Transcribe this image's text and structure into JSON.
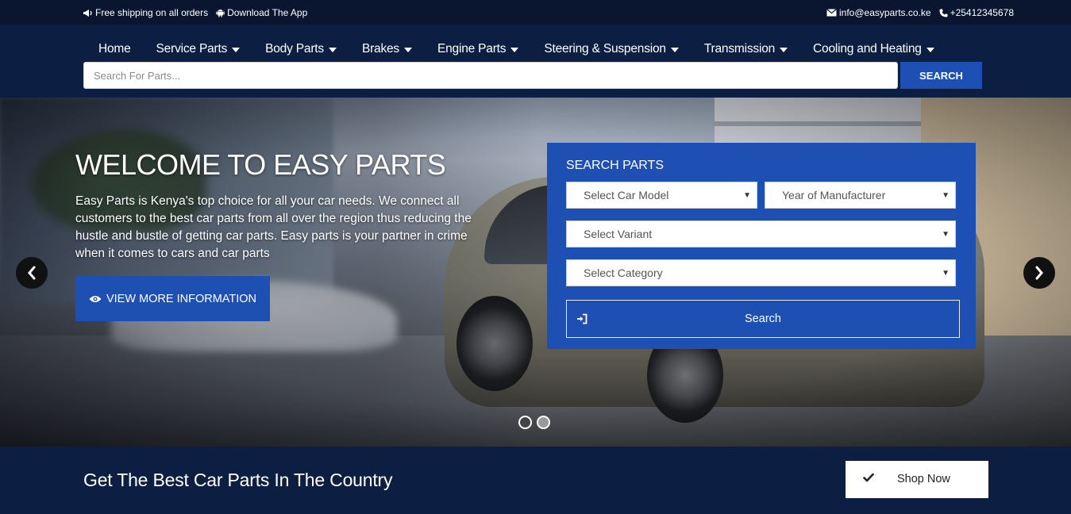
{
  "topbar": {
    "shipping_text": "Free shipping on all orders",
    "shipping_icon": "megaphone-icon",
    "app_text": "Download The App",
    "app_icon": "android-icon",
    "email": "info@easyparts.co.ke",
    "email_icon": "envelope-icon",
    "phone": "+25412345678",
    "phone_icon": "phone-icon"
  },
  "nav": {
    "items": [
      {
        "label": "Home",
        "has_dropdown": false
      },
      {
        "label": "Service Parts",
        "has_dropdown": true
      },
      {
        "label": "Body Parts",
        "has_dropdown": true
      },
      {
        "label": "Brakes",
        "has_dropdown": true
      },
      {
        "label": "Engine Parts",
        "has_dropdown": true
      },
      {
        "label": "Steering & Suspension",
        "has_dropdown": true
      },
      {
        "label": "Transmission",
        "has_dropdown": true
      },
      {
        "label": "Cooling and Heating",
        "has_dropdown": true
      }
    ]
  },
  "search": {
    "placeholder": "Search For Parts...",
    "button_label": "SEARCH"
  },
  "hero": {
    "title": "WELCOME TO EASY PARTS",
    "description": "Easy Parts is Kenya's top choice for all your car needs. We connect all customers to the best car parts from all over the region thus reducing the hustle and bustle of getting car parts. Easy parts is your partner in crime when it comes to cars and car parts",
    "more_button_label": "VIEW MORE INFORMATION",
    "more_button_icon": "eye-icon",
    "prev_icon": "chevron-left-icon",
    "next_icon": "chevron-right-icon",
    "slide_count": 2,
    "active_slide": 2
  },
  "search_panel": {
    "title": "SEARCH PARTS",
    "car_model": "Select Car Model",
    "year": "Year of Manufacturer",
    "variant": "Select Variant",
    "category": "Select Category",
    "search_label": "Search",
    "search_icon": "sign-in-icon"
  },
  "cta": {
    "title": "Get The Best Car Parts In The Country",
    "button_label": "Shop Now",
    "button_icon": "check-icon"
  },
  "colors": {
    "topbar_bg": "#0a1630",
    "nav_bg": "#0c1f42",
    "accent_blue": "#1e50b4",
    "white": "#ffffff"
  }
}
